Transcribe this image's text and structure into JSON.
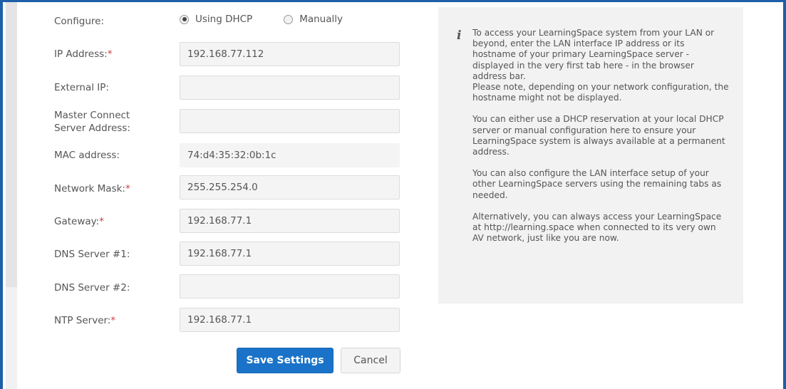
{
  "configure": {
    "label": "Configure:",
    "options": [
      {
        "label": "Using DHCP",
        "checked": true
      },
      {
        "label": "Manually",
        "checked": false
      }
    ]
  },
  "fields": {
    "ip_address": {
      "label": "IP Address:",
      "required": "*",
      "value": "192.168.77.112"
    },
    "external_ip": {
      "label": "External IP:",
      "value": ""
    },
    "master_connect_line1": "Master Connect",
    "master_connect_line2": "Server Address:",
    "master_connect_value": "",
    "mac_address": {
      "label": "MAC address:",
      "value": "74:d4:35:32:0b:1c"
    },
    "network_mask": {
      "label": "Network Mask:",
      "required": "*",
      "value": "255.255.254.0"
    },
    "gateway": {
      "label": "Gateway:",
      "required": "*",
      "value": "192.168.77.1"
    },
    "dns1": {
      "label": "DNS Server #1:",
      "value": "192.168.77.1"
    },
    "dns2": {
      "label": "DNS Server #2:",
      "value": ""
    },
    "ntp": {
      "label": "NTP Server:",
      "required": "*",
      "value": "192.168.77.1"
    }
  },
  "info": {
    "icon": "i",
    "paragraphs": [
      "To access your LearningSpace system from your LAN or beyond, enter the LAN interface IP address or its hostname of your primary LearningSpace server - displayed in the very first tab here - in the browser address bar.",
      "Please note, depending on your network configuration, the hostname might not be displayed.",
      "You can either use a DHCP reservation at your local DHCP server or manual configuration here to ensure your LearningSpace system is always available at a permanent address.",
      "You can also configure the LAN interface setup of your other LearningSpace servers using the remaining tabs as needed.",
      "Alternatively, you can always access your LearningSpace at http://learning.space when connected to its very own AV network, just like you are now."
    ]
  },
  "buttons": {
    "save": "Save Settings",
    "cancel": "Cancel"
  },
  "colors": {
    "accent": "#1a73c8",
    "frame": "#1d5fa8",
    "required": "#d13b3b"
  }
}
